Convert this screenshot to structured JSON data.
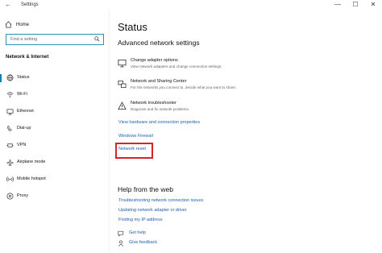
{
  "window": {
    "title": "Settings",
    "back_glyph": "←",
    "minimize_glyph": "—",
    "maximize_glyph": "☐",
    "close_glyph": "✕"
  },
  "sidebar": {
    "home_label": "Home",
    "search_placeholder": "Find a setting",
    "section_title": "Network & Internet",
    "items": [
      {
        "label": "Status",
        "icon": "globe-icon",
        "selected": true
      },
      {
        "label": "Wi-Fi",
        "icon": "wifi-icon",
        "selected": false
      },
      {
        "label": "Ethernet",
        "icon": "ethernet-icon",
        "selected": false
      },
      {
        "label": "Dial-up",
        "icon": "dialup-icon",
        "selected": false
      },
      {
        "label": "VPN",
        "icon": "vpn-icon",
        "selected": false
      },
      {
        "label": "Airplane mode",
        "icon": "airplane-icon",
        "selected": false
      },
      {
        "label": "Mobile hotspot",
        "icon": "hotspot-icon",
        "selected": false
      },
      {
        "label": "Proxy",
        "icon": "proxy-icon",
        "selected": false
      }
    ]
  },
  "main": {
    "page_title": "Status",
    "advanced_title": "Advanced network settings",
    "settings": [
      {
        "title": "Change adapter options",
        "desc": "View network adapters and change connection settings.",
        "icon": "adapter-icon"
      },
      {
        "title": "Network and Sharing Center",
        "desc": "For the networks you connect to, decide what you want to share.",
        "icon": "sharing-center-icon"
      },
      {
        "title": "Network troubleshooter",
        "desc": "Diagnose and fix network problems.",
        "icon": "warning-icon"
      }
    ],
    "links": [
      "View hardware and connection properties",
      "Windows Firewall",
      "Network reset"
    ],
    "help_title": "Help from the web",
    "help_links": [
      "Troubleshooting network connection issues",
      "Updating network adapter or driver",
      "Finding my IP address"
    ],
    "get_help_label": "Get help",
    "feedback_label": "Give feedback"
  },
  "colors": {
    "accent": "#0a7dbd",
    "link": "#1a5fb4",
    "highlight": "#d9232b"
  }
}
